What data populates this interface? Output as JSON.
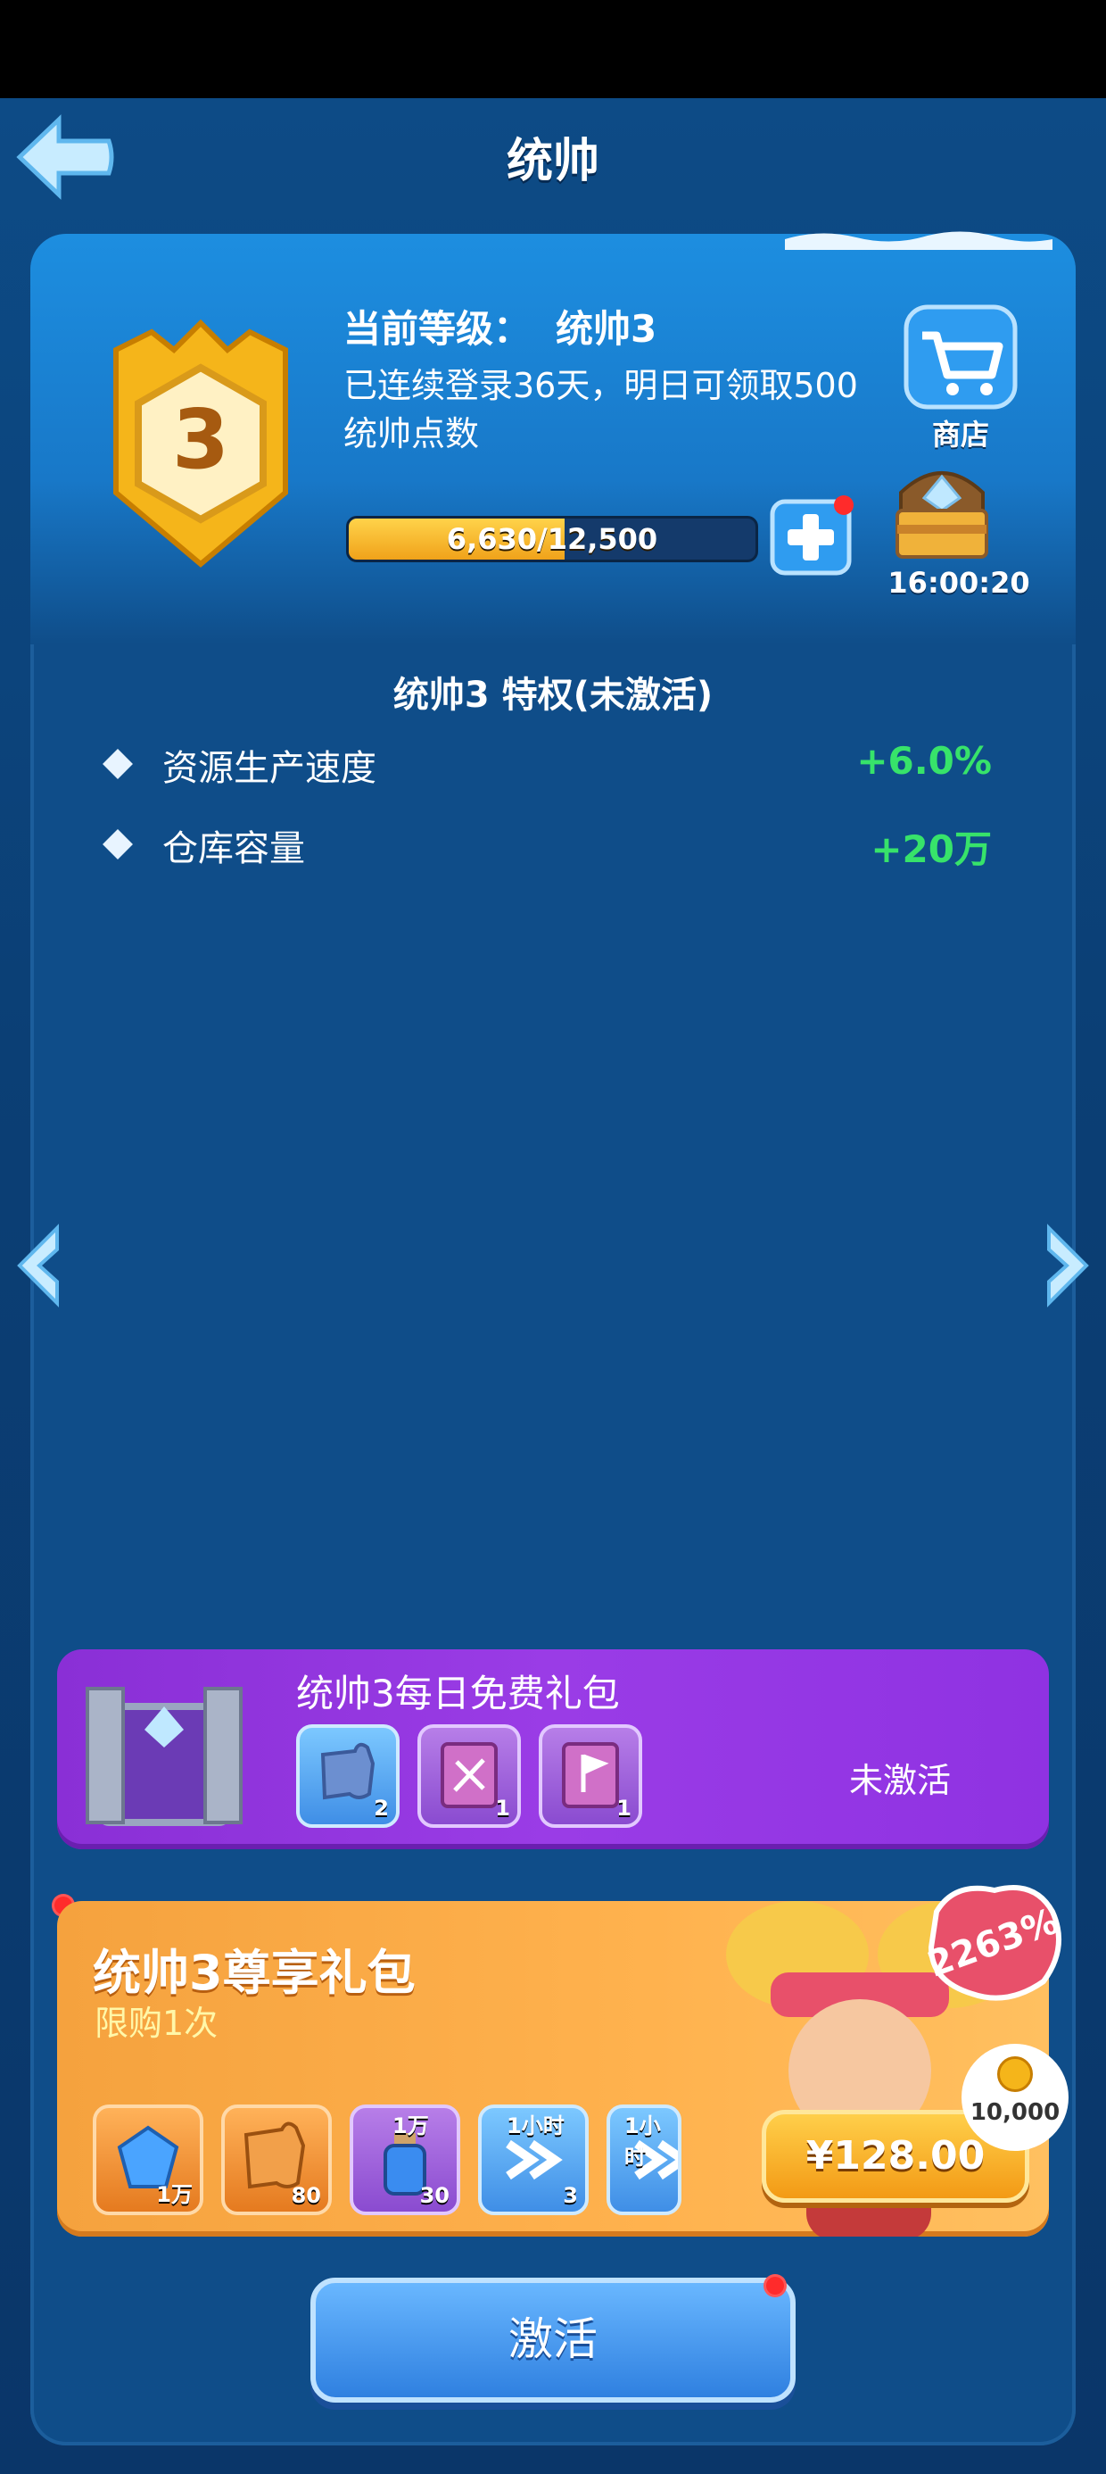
{
  "header": {
    "title": "统帅"
  },
  "level": {
    "label": "当前等级：",
    "value": "统帅3",
    "badge_number": "3",
    "login_text": "已连续登录36天，明日可领取500统帅点数"
  },
  "shop": {
    "label": "商店"
  },
  "progress": {
    "text": "6,630/12,500",
    "fraction": 0.53
  },
  "chest": {
    "timer": "16:00:20"
  },
  "privileges": {
    "title": "统帅3 特权(未激活)",
    "items": [
      {
        "name": "资源生产速度",
        "value": "+6.0%"
      },
      {
        "name": "仓库容量",
        "value": "+20万"
      }
    ]
  },
  "free_pack": {
    "title": "统帅3每日免费礼包",
    "status": "未激活",
    "items": [
      {
        "icon": "puzzle-icon",
        "qty": "2"
      },
      {
        "icon": "sword-book-icon",
        "qty": "1"
      },
      {
        "icon": "flag-book-icon",
        "qty": "1"
      }
    ]
  },
  "vip_pack": {
    "title": "统帅3尊享礼包",
    "limit": "限购1次",
    "discount": "2263%",
    "coins": "10,000",
    "price": "¥128.00",
    "items": [
      {
        "icon": "gem-icon",
        "top": "",
        "qty": "1万"
      },
      {
        "icon": "hero-puzzle-icon",
        "top": "",
        "qty": "80"
      },
      {
        "icon": "potion-icon",
        "top": "1万",
        "qty": "30"
      },
      {
        "icon": "speedup-sword-icon",
        "top": "1小时",
        "qty": "3"
      },
      {
        "icon": "speedup-build-icon",
        "top": "1小时",
        "qty": ""
      }
    ]
  },
  "activate": {
    "label": "激活"
  },
  "colors": {
    "accent_green": "#37e36a",
    "free_pack_purple": "#9a3ce6",
    "vip_orange": "#ffb24e",
    "button_blue": "#2f80e0"
  }
}
